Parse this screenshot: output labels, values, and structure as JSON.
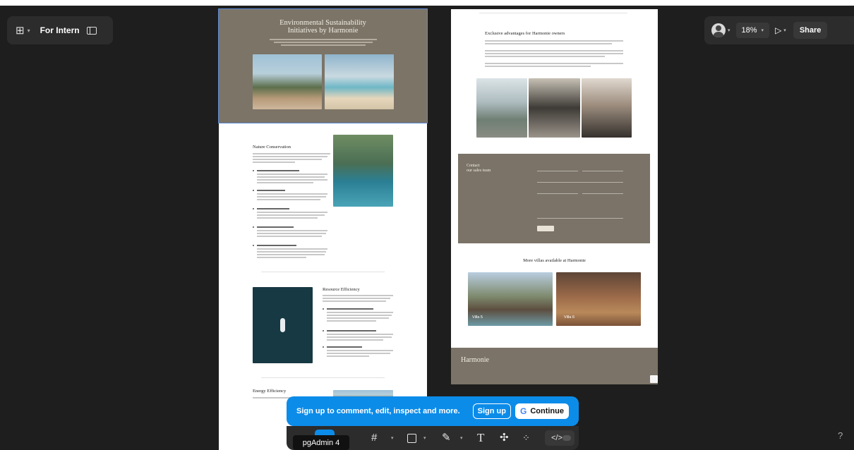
{
  "toolbar_top_left": {
    "file_name": "For Intern"
  },
  "toolbar_top_right": {
    "zoom": "18%",
    "share_label": "Share"
  },
  "left_frame": {
    "hero_title_line1": "Environmental Sustainability",
    "hero_title_line2": "Initiatives by Harmonie",
    "section_nature": "Nature Conservation",
    "section_resource": "Resource Efficiency",
    "section_energy": "Energy Efficiency"
  },
  "right_frame": {
    "advantages_title": "Exclusive advantages for Harmonie owners",
    "contact_title_line1": "Contact",
    "contact_title_line2": "our sales team",
    "villas_title": "More villas available at Harmonie",
    "villa_5": "Villa 5",
    "villa_6": "Villa 6",
    "footer_logo": "Harmonie"
  },
  "banner": {
    "message": "Sign up to comment, edit, inspect and more.",
    "signup_label": "Sign up",
    "continue_label": "Continue"
  },
  "tooltip": "pgAdmin 4",
  "help": "?",
  "colors": {
    "canvas": "#1e1e1e",
    "accent": "#0c8ce9",
    "hero_brown": "#7c7467"
  }
}
